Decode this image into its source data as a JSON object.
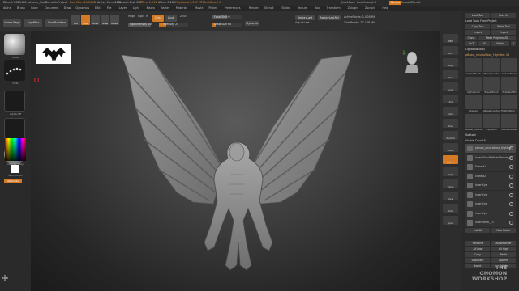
{
  "titlebar": {
    "app": "ZBrush 2024.6.6 sutherin_ToolDemoFileProject",
    "stats": [
      "Free Mem 11.54KB",
      "Active Mem 4434",
      "Scratch Disk 629",
      "ZTime 1.011",
      "ATime 0.182",
      "PolyCount 6.347 MP",
      "MeshCount 9"
    ],
    "quicksave": "QuickSave",
    "see_through": "See-through 0",
    "menus_btn": "Menus",
    "script": "DefaultZScript"
  },
  "menubar": [
    "Alpha",
    "Brush",
    "Color",
    "Document",
    "Draw",
    "Dynamics",
    "Edit",
    "File",
    "Layer",
    "Light",
    "Macro",
    "Marker",
    "Material",
    "Movie",
    "Picker",
    "Preferences",
    "Render",
    "Stencil",
    "Stroke",
    "Texture",
    "Tool",
    "Transform",
    "Zplugin",
    "Zscript",
    "Help"
  ],
  "toolbar": {
    "home": "Home Page",
    "lightbox": "LightBox",
    "live_boolean": "Live Boolean",
    "modes": [
      "Edit",
      "Draw",
      "Move",
      "Scale",
      "Rotate"
    ],
    "mrgb": "Mrgb",
    "rgb": "Rgb",
    "m": "M",
    "zadd": "Zadd",
    "zsub": "Zsub",
    "zcut": "Zcut",
    "rgb_intensity": "Rgb Intensity 100",
    "z_intensity": "Z Intensity 25",
    "focal_shift": "Focal Shift 0",
    "draw_size": "Draw Size 64",
    "dynamic": "Dynamic",
    "replay_last": "ReplayLast",
    "replay_last_rel": "ReplayLastRel",
    "active_points": "ActivePoints: 1.008 Mil",
    "total_points": "TotalPoints: 27.188 Mil",
    "adjust": "AdjustLast 1"
  },
  "leftpanel": {
    "brush": "Move",
    "stroke": "Dots",
    "alpha": "Alpha Off",
    "texture": "Texture Off",
    "material": "MatCap Gray",
    "gradient": "Gradient",
    "switch_color": "SwitchColor",
    "alternate": "Alternate"
  },
  "rightshelf": [
    "BPR",
    "SPix 3",
    "Persp",
    "Floor",
    "Local",
    "L.Sym",
    "Frame",
    "Move",
    "Zoom3D",
    "Rotate",
    "Line Fill",
    "PolyF",
    "Transp",
    "Ghost",
    "Solo",
    "Xpose"
  ],
  "rightpanel": {
    "rows_top": [
      "Load Tool",
      "Save As",
      "Load Tools From Project",
      "Copy Tool",
      "Paste Tool",
      "Import",
      "Export",
      "Clone",
      "Make PolyMesh3D",
      "GoZ",
      "All",
      "Visible",
      "R",
      "Lightbox▸Tools"
    ],
    "tool_title": "pBeast_neutralPose_HighRes: 48",
    "tools": [
      "SimpleBrush",
      "pBeast_neutral",
      "SphereBrush",
      "AlphaBrush",
      "EraserBrush",
      "PolyMesh3D",
      "ZSphere",
      "pBeast_neutral",
      "TMPolyMesh_1",
      "pBeast_neutral",
      "ZSpheres",
      "insertGhoulNe"
    ],
    "subtool_label": "Subtool",
    "visible_count": "Visible Count 9",
    "subtools": [
      "pBeast_neutralPose_HighRes",
      "insertGhoulRefinedTexture_R",
      "Extract1",
      "Extract2",
      "insertEye",
      "insertEye",
      "insertEye",
      "insertEye",
      "insertTeeth_13"
    ],
    "list_all": "List All",
    "new_folder": "New Folder",
    "rename": "Rename",
    "auto_reorder": "AutoReorder",
    "all_low": "All Low",
    "all_high": "All High",
    "copy": "Copy",
    "paste": "Paste",
    "duplicate": "Duplicate",
    "append": "Append",
    "insert": "Insert",
    "delete": "Delete"
  },
  "watermark": [
    "THE",
    "GNOMON",
    "WORKSHOP"
  ],
  "colors": {
    "accent": "#d57a24",
    "panel": "#2a2a2a",
    "viewport_center": "#5a5a5a"
  }
}
